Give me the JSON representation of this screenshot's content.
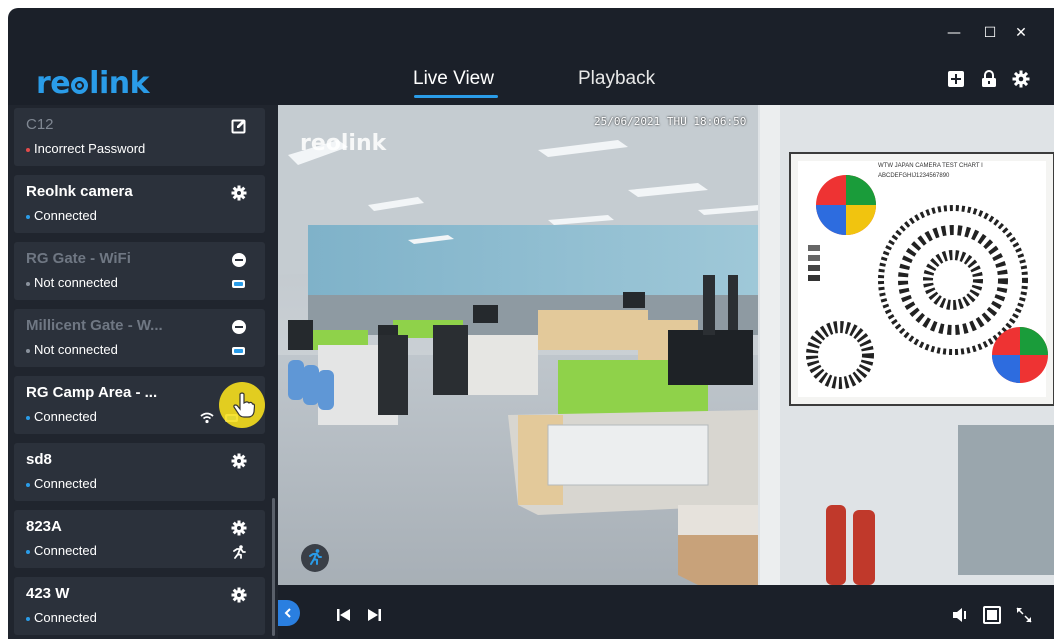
{
  "window": {
    "minimize": "—",
    "maximize": "☐",
    "close": "✕"
  },
  "header": {
    "logo_text": "reolink",
    "tabs": [
      {
        "label": "Live View",
        "active": true
      },
      {
        "label": "Playback",
        "active": false
      }
    ]
  },
  "cameras": [
    {
      "name": "C12",
      "status": "Incorrect Password",
      "status_color": "#e24b4b",
      "state": "error",
      "icon": "edit-icon"
    },
    {
      "name": "Reolnk camera",
      "status": "Connected",
      "status_color": "#2a9ce8",
      "state": "connected",
      "icon": "gear-icon"
    },
    {
      "name": "RG Gate - WiFi",
      "status": "Not connected",
      "status_color": "#8a929d",
      "state": "disconnected",
      "icon": "minus-circle-icon",
      "icon2": "battery-icon"
    },
    {
      "name": "Millicent Gate - W...",
      "status": "Not connected",
      "status_color": "#8a929d",
      "state": "disconnected",
      "icon": "minus-circle-icon",
      "icon2": "battery-icon"
    },
    {
      "name": "RG Camp Area - ...",
      "status": "Connected",
      "status_color": "#2a9ce8",
      "state": "connected",
      "icon": "gear-icon",
      "icon2": "wifi-battery-icon"
    },
    {
      "name": "sd8",
      "status": "Connected",
      "status_color": "#2a9ce8",
      "state": "connected",
      "icon": "gear-icon"
    },
    {
      "name": "823A",
      "status": "Connected",
      "status_color": "#2a9ce8",
      "state": "connected",
      "icon": "gear-icon",
      "icon2": "motion-icon"
    },
    {
      "name": "423 W",
      "status": "Connected",
      "status_color": "#2a9ce8",
      "state": "connected",
      "icon": "gear-icon"
    }
  ],
  "video": {
    "watermark": "reolink",
    "timestamp": "25/06/2021 THU 18:06:50",
    "chart_title": "WTW JAPAN CAMERA TEST CHART I",
    "chart_line": "ABCDEFGHIJ1234567890"
  },
  "colors": {
    "accent": "#2a9ce8",
    "background": "#1b2029",
    "card": "#2b313b",
    "highlight": "#f6df1e"
  }
}
